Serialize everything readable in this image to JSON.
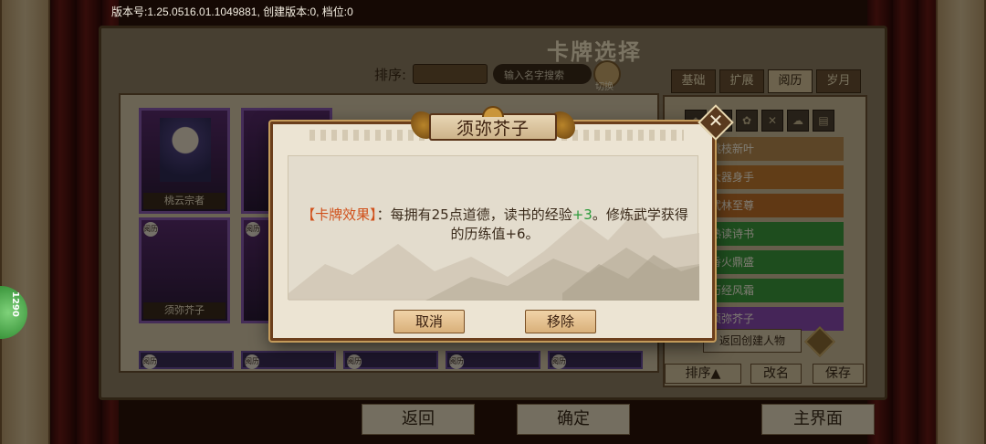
{
  "status_bar": {
    "version": "版本号:1.25.0516.01.1049881, 创建版本:0, 档位:0"
  },
  "screen": {
    "title": "卡牌选择",
    "sort_label": "排序:",
    "sort_value": "",
    "search_placeholder": "输入名字搜索",
    "switch_label": "切换",
    "tabs": [
      "基础",
      "扩展",
      "阅历",
      "岁月"
    ],
    "active_tab": "阅历",
    "cards": [
      {
        "name": "桃云宗者"
      },
      {
        "name": "须弥芥子"
      }
    ],
    "badge": "阅历",
    "right_list": [
      {
        "label": "桃枝新叶",
        "color": "#b88a4e"
      },
      {
        "label": "大器身手",
        "color": "#c27a2e"
      },
      {
        "label": "武林至尊",
        "color": "#c07028"
      },
      {
        "label": "熟读诗书",
        "color": "#3c9a3c"
      },
      {
        "label": "香火鼎盛",
        "color": "#3c9a3c"
      },
      {
        "label": "历经风霜",
        "color": "#3c9a3c"
      },
      {
        "label": "须弥芥子",
        "color": "#8a4ab0"
      }
    ],
    "back_create_label": "返回创建人物",
    "sort_btn_label": "排序▲",
    "rename_label": "改名",
    "save_label": "保存",
    "bottom_back": "返回",
    "bottom_confirm": "确定",
    "bottom_main": "主界面",
    "side_counter": "1290"
  },
  "dialog": {
    "title": "须弥芥子",
    "effect_tag": "【卡牌效果】",
    "effect_sep": "：",
    "effect_text_1": "每拥有25点道德，读书的经验",
    "effect_plus": "+3",
    "effect_text_2": "。修炼武学获得的历练值+6。",
    "cancel_label": "取消",
    "remove_label": "移除",
    "close_symbol": "✕"
  },
  "colors": {
    "accent_orange": "#d0501a",
    "positive_green": "#2b9a3a",
    "frame_brown": "#6b3e1c"
  }
}
